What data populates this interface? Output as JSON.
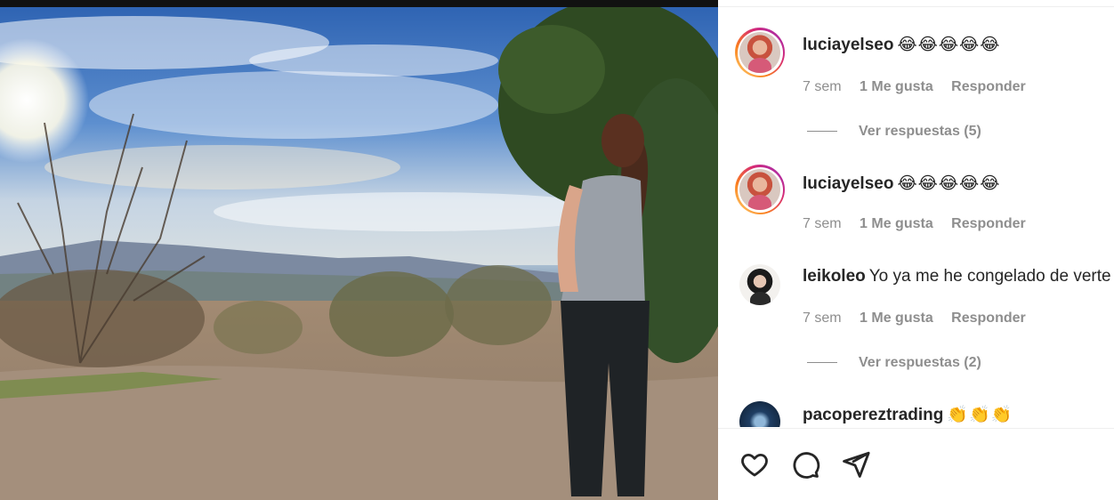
{
  "post": {
    "comments": [
      {
        "username": "luciayelseo",
        "text": "😂😂😂😂😂",
        "time": "7 sem",
        "likes": "1 Me gusta",
        "reply_label": "Responder",
        "view_replies": "Ver respuestas (5)",
        "avatar": "lucia-avatar",
        "story_ring": true
      },
      {
        "username": "luciayelseo",
        "text": "😂😂😂😂😂",
        "time": "7 sem",
        "likes": "1 Me gusta",
        "reply_label": "Responder",
        "avatar": "lucia-avatar",
        "story_ring": true
      },
      {
        "username": "leikoleo",
        "text": "Yo ya me he congelado de verte",
        "time": "7 sem",
        "likes": "1 Me gusta",
        "reply_label": "Responder",
        "view_replies": "Ver respuestas (2)",
        "avatar": "leiko-avatar",
        "story_ring": false
      },
      {
        "username": "pacopereztrading",
        "text": "👏👏👏",
        "avatar": "paco-avatar",
        "story_ring": false
      }
    ],
    "actions": [
      {
        "icon": "heart-icon"
      },
      {
        "icon": "comment-icon"
      },
      {
        "icon": "share-icon"
      }
    ],
    "colors": {
      "text_primary": "#262626",
      "text_secondary": "#8e8e8e",
      "divider": "#efefef",
      "story_ring": [
        "#feda75",
        "#fa7e1e",
        "#d62976",
        "#962fbf"
      ]
    }
  }
}
